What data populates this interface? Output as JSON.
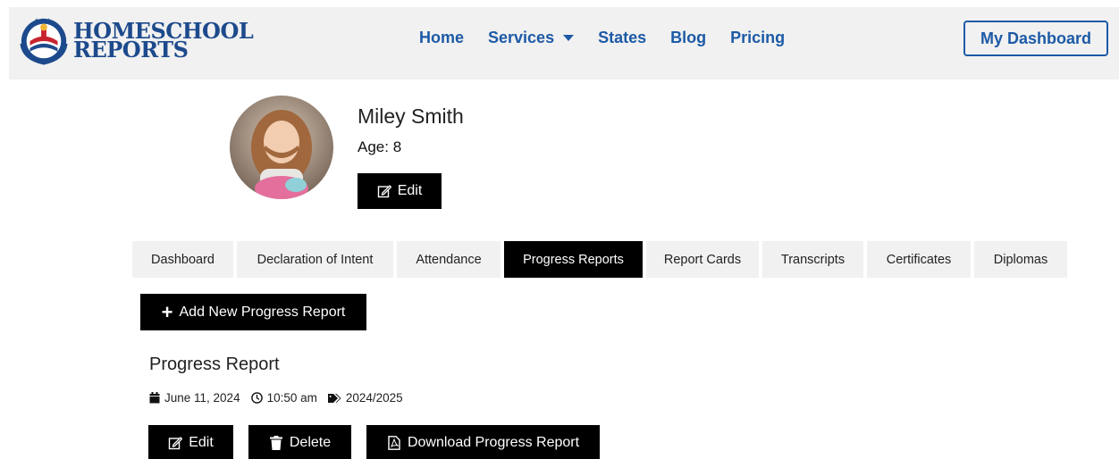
{
  "brand": {
    "line1": "HOMESCHOOL",
    "line2": "REPORTS"
  },
  "nav": {
    "home": "Home",
    "services": "Services",
    "states": "States",
    "blog": "Blog",
    "pricing": "Pricing"
  },
  "header": {
    "dashboard_button": "My Dashboard"
  },
  "student": {
    "name": "Miley Smith",
    "age": "Age: 8",
    "edit_label": "Edit"
  },
  "tabs": [
    {
      "label": "Dashboard"
    },
    {
      "label": "Declaration of Intent"
    },
    {
      "label": "Attendance"
    },
    {
      "label": "Progress Reports"
    },
    {
      "label": "Report Cards"
    },
    {
      "label": "Transcripts"
    },
    {
      "label": "Certificates"
    },
    {
      "label": "Diplomas"
    }
  ],
  "active_tab": "Progress Reports",
  "actions": {
    "add_new": "Add New Progress Report"
  },
  "report": {
    "title": "Progress Report",
    "date": "June 11, 2024",
    "time": "10:50 am",
    "school_year": "2024/2025",
    "edit_label": "Edit",
    "delete_label": "Delete",
    "download_label": "Download Progress Report"
  },
  "colors": {
    "brand_blue": "#1d5aa6",
    "brand_red": "#c8242f",
    "button_black": "#000000",
    "header_bg": "#f1f1f1"
  },
  "icons": [
    "emblem-logo",
    "caret-down-icon",
    "edit-icon",
    "plus-icon",
    "calendar-icon",
    "clock-icon",
    "tag-icon",
    "trash-icon",
    "pdf-icon"
  ]
}
